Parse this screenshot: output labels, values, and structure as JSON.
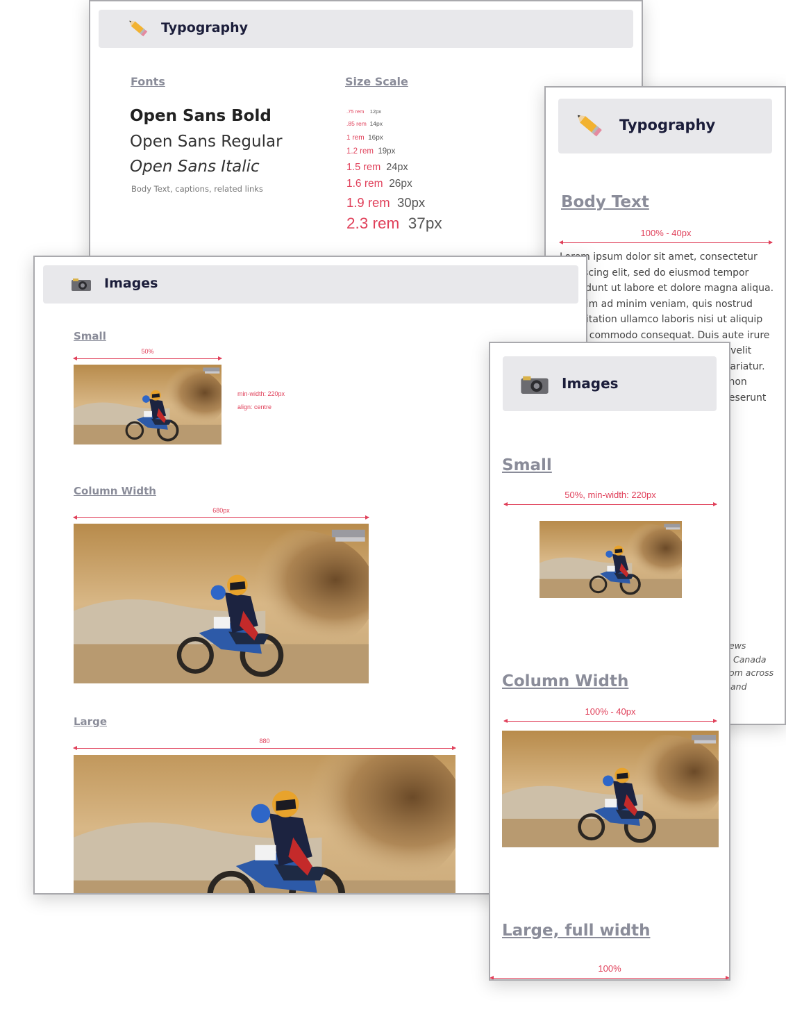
{
  "typo_desktop": {
    "title": "Typography",
    "fonts_heading": "Fonts",
    "scale_heading": "Size Scale",
    "fonts": [
      "Open Sans Bold",
      "Open Sans Regular",
      "Open Sans Italic"
    ],
    "fonts_caption": "Body Text, captions, related links",
    "scale": [
      {
        "rem": ".75 rem",
        "px": "12px"
      },
      {
        "rem": ".85 rem",
        "px": "14px"
      },
      {
        "rem": "1 rem",
        "px": "16px"
      },
      {
        "rem": "1.2 rem",
        "px": "19px"
      },
      {
        "rem": "1.5 rem",
        "px": "24px"
      },
      {
        "rem": "1.6 rem",
        "px": "26px"
      },
      {
        "rem": "1.9 rem",
        "px": "30px"
      },
      {
        "rem": "2.3 rem",
        "px": "37px"
      }
    ]
  },
  "typo_mobile": {
    "title": "Typography",
    "body_heading": "Body Text",
    "width_label": "100% - 40px",
    "lines": [
      "Lorem ipsum dolor sit amet, consectetur",
      "adipiscing elit, sed do eiusmod tempor",
      "incididunt ut labore et dolore magna aliqua.",
      "Ut enim ad minim veniam, quis nostrud",
      "exercitation ullamco laboris nisi ut aliquip",
      "ex ea commodo consequat. Duis aute irure",
      "dolor in reprehenderit in voluptate velit",
      "esse cillum dolore eu fugiat nulla pariatur.",
      "Excepteur sint occaecat cupidatat non",
      "proident, sunt in culpa qui officia deserunt"
    ],
    "italic_lines": [
      "ews",
      "Canada",
      "om across",
      "and"
    ]
  },
  "images_desktop": {
    "title": "Images",
    "small_heading": "Small",
    "small_measure": "50%",
    "small_note1": "min-width: 220px",
    "small_note2": "align: centre",
    "column_heading": "Column Width",
    "column_measure": "680px",
    "large_heading": "Large",
    "large_measure": "880"
  },
  "images_mobile": {
    "title": "Images",
    "small_heading": "Small",
    "small_measure": "50%, min-width: 220px",
    "column_heading": "Column Width",
    "column_measure": "100% - 40px",
    "large_heading": "Large, full width",
    "large_measure": "100%"
  },
  "colors": {
    "accent": "#e0405a",
    "heading": "#8a8c99",
    "header_bg": "#e8e8eb",
    "title": "#1b1d3a"
  },
  "icons": {
    "typography": "pencil-icon",
    "images": "camera-icon"
  }
}
